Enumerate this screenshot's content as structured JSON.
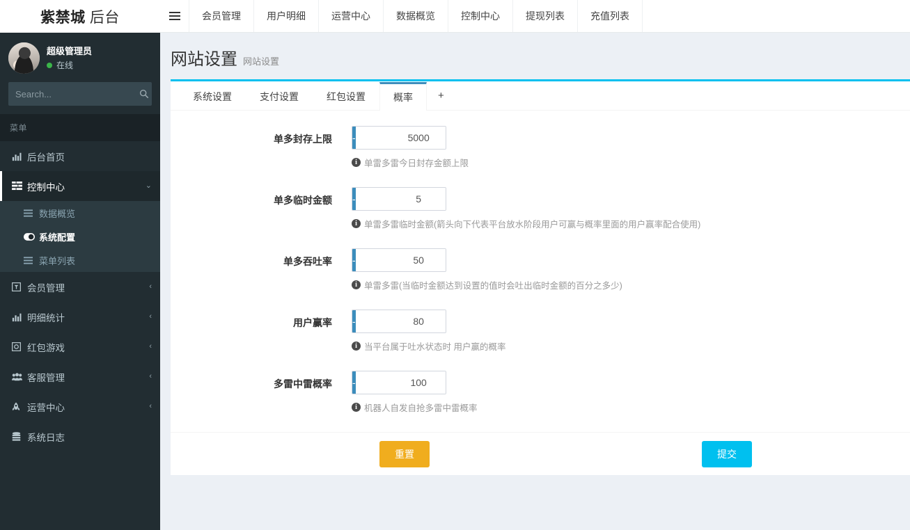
{
  "brand": {
    "name": "紫禁城",
    "suffix": "后台"
  },
  "topnav": {
    "toggle_icon": "hamburger-icon",
    "items": [
      {
        "label": "会员管理"
      },
      {
        "label": "用户明细"
      },
      {
        "label": "运营中心"
      },
      {
        "label": "数据概览"
      },
      {
        "label": "控制中心"
      },
      {
        "label": "提现列表"
      },
      {
        "label": "充值列表"
      }
    ]
  },
  "sidebar": {
    "user": {
      "name": "超级管理员",
      "status": "在线",
      "status_color": "#3bb54a",
      "avatar_icon": "user-avatar"
    },
    "search": {
      "placeholder": "Search...",
      "value": "",
      "icon": "search-icon"
    },
    "menu_header": "菜单",
    "items": [
      {
        "label": "后台首页",
        "icon": "bar-chart-icon",
        "arrow": "",
        "state": ""
      },
      {
        "label": "控制中心",
        "icon": "list-alt-icon",
        "arrow": "⌄",
        "state": "open"
      },
      {
        "label": "会员管理",
        "icon": "id-card-icon",
        "arrow": "‹",
        "state": ""
      },
      {
        "label": "明细统计",
        "icon": "bar-chart-icon",
        "arrow": "‹",
        "state": ""
      },
      {
        "label": "红包游戏",
        "icon": "gift-box-icon",
        "arrow": "‹",
        "state": ""
      },
      {
        "label": "客服管理",
        "icon": "users-icon",
        "arrow": "‹",
        "state": ""
      },
      {
        "label": "运营中心",
        "icon": "rocket-icon",
        "arrow": "‹",
        "state": ""
      },
      {
        "label": "系统日志",
        "icon": "database-icon",
        "arrow": "",
        "state": ""
      }
    ],
    "submenu": [
      {
        "label": "数据概览",
        "icon": "list-icon",
        "active": false
      },
      {
        "label": "系统配置",
        "icon": "toggle-on-icon",
        "active": true
      },
      {
        "label": "菜单列表",
        "icon": "list-icon",
        "active": false
      }
    ]
  },
  "page": {
    "title": "网站设置",
    "subtitle": "网站设置"
  },
  "tabs": {
    "items": [
      {
        "label": "系统设置",
        "active": false
      },
      {
        "label": "支付设置",
        "active": false
      },
      {
        "label": "红包设置",
        "active": false
      },
      {
        "label": "概率",
        "active": true
      }
    ],
    "add_label": "+"
  },
  "form": {
    "minus_label": "-",
    "plus_label": "+",
    "rows": [
      {
        "label": "单多封存上限",
        "value": "5000",
        "help": "单雷多雷今日封存金额上限"
      },
      {
        "label": "单多临时金额",
        "value": "5",
        "help": "单雷多雷临时金额(箭头向下代表平台放水阶段用户可赢与概率里面的用户赢率配合使用)"
      },
      {
        "label": "单多吞吐率",
        "value": "50",
        "help": "单雷多雷(当临时金额达到设置的值时会吐出临时金额的百分之多少)"
      },
      {
        "label": "用户赢率",
        "value": "80",
        "help": "当平台属于吐水状态时 用户赢的概率"
      },
      {
        "label": "多雷中雷概率",
        "value": "100",
        "help": "机器人自发自抢多雷中雷概率"
      }
    ]
  },
  "footer": {
    "reset_label": "重置",
    "submit_label": "提交",
    "reset_color": "#f0ad1e",
    "submit_color": "#00c0ef"
  },
  "colors": {
    "sidebar_bg": "#222d32",
    "submenu_bg": "#2c3b41",
    "content_bg": "#ecf0f5",
    "box_accent": "#00c0ef",
    "tab_accent": "#3c8dbc",
    "minus_btn": "#3c8dbc",
    "plus_btn": "#00a65a"
  }
}
